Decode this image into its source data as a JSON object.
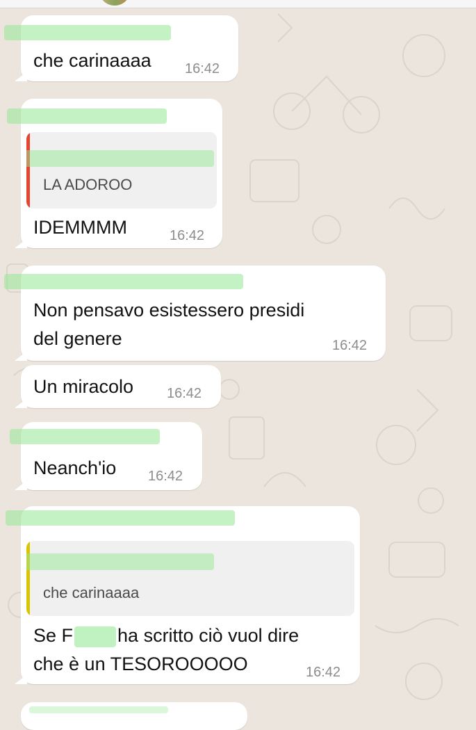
{
  "colors": {
    "chat_background": "#ece5dd",
    "bubble": "#ffffff",
    "reply_bar_red": "#e5452f",
    "reply_bar_yellow": "#d9c400",
    "timestamp": "#8c8c8c",
    "redaction_mark": "#96e896"
  },
  "messages": [
    {
      "text": "che carinaaaa",
      "time": "16:42"
    },
    {
      "quote": {
        "text": "LA ADOROO"
      },
      "text": "IDEMMMM",
      "time": "16:42"
    },
    {
      "text": "Non pensavo esistessero presidi\ndel genere",
      "time": "16:42"
    },
    {
      "text": "Un miracolo",
      "time": "16:42"
    },
    {
      "text": "Neanch'io",
      "time": "16:42"
    },
    {
      "quote": {
        "text": "che carinaaaa"
      },
      "text_part1": "Se F",
      "text_part2": "ha scritto ciò vuol dire\nche è un TESOROOOOO",
      "time": "16:42"
    }
  ]
}
